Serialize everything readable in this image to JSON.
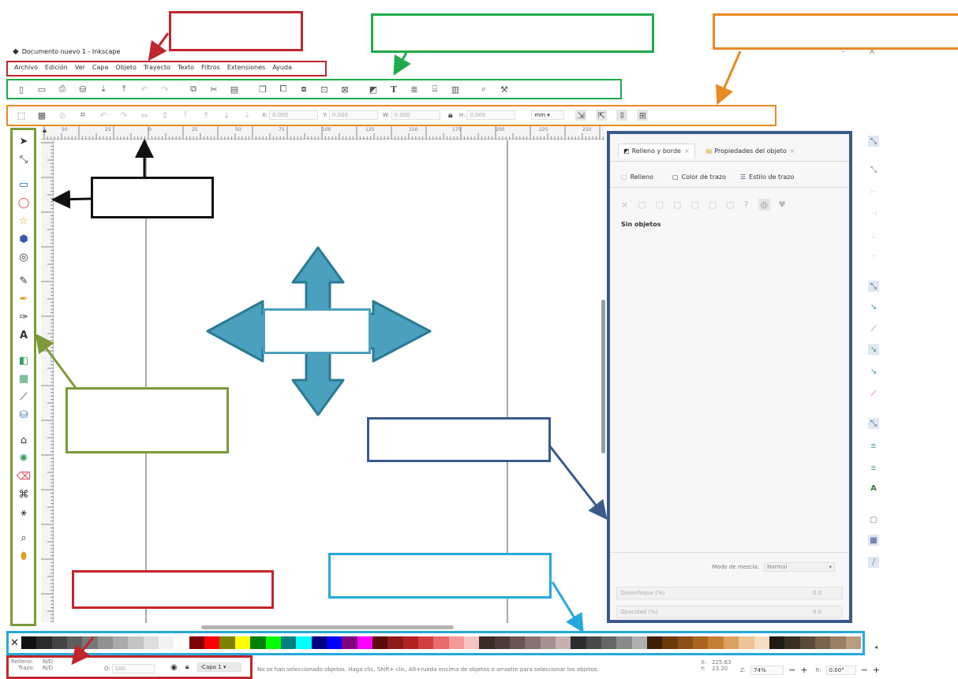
{
  "window": {
    "title": "Documento nuevo 1 - Inkscape"
  },
  "menu": [
    "Archivo",
    "Edición",
    "Ver",
    "Capa",
    "Objeto",
    "Trayecto",
    "Texto",
    "Filtros",
    "Extensiones",
    "Ayuda"
  ],
  "toolbar": {
    "icons": [
      "new-icon",
      "open-icon",
      "print-icon",
      "save-icon",
      "import-icon",
      "export-icon",
      "undo-icon",
      "redo-icon",
      "copy-icon",
      "cut-icon",
      "paste-icon",
      "duplicate-icon",
      "clone-icon",
      "unlink-icon",
      "group-icon",
      "ungroup-icon",
      "fill-stroke-icon",
      "text-icon",
      "layers-icon",
      "xml-icon",
      "align-icon",
      "zoom-icon",
      "preferences-icon"
    ],
    "text_glyph": "T"
  },
  "commands": {
    "x_label": "X:",
    "x_value": "0.000",
    "y_label": "Y:",
    "y_value": "0.000",
    "w_label": "W:",
    "w_value": "0.000",
    "h_label": "H:",
    "h_value": "0.000",
    "unit": "mm"
  },
  "ruler": {
    "labels": [
      "50",
      "25",
      "0",
      "25",
      "50",
      "75",
      "100",
      "125",
      "150",
      "175",
      "200",
      "225",
      "250"
    ]
  },
  "panel": {
    "tabs": [
      "Relleno y borde",
      "Propiedades del objeto"
    ],
    "subtabs": [
      "Relleno",
      "Color de trazo",
      "Estilo de trazo"
    ],
    "paint_icons": [
      "×",
      "?"
    ],
    "status": "Sin objetos",
    "blend_label": "Modo de mezcla:",
    "blend_value": "Normal",
    "blur_label": "Desenfoque (%)",
    "blur_value": "0.0",
    "opacity_label": "Opacidad (%)",
    "opacity_value": "0.0"
  },
  "palette": {
    "colors": [
      "#111111",
      "#2b2b2b",
      "#444444",
      "#5e5e5e",
      "#777777",
      "#919191",
      "#aaaaaa",
      "#c4c4c4",
      "#dddddd",
      "#f2f2f2",
      "#ffffff",
      "#800000",
      "#ff0000",
      "#808000",
      "#ffff00",
      "#008000",
      "#00ff00",
      "#008080",
      "#00ffff",
      "#000080",
      "#0000ff",
      "#800080",
      "#ff00ff",
      "#5c0a0a",
      "#8c1a1a",
      "#b22222",
      "#d33f3f",
      "#e86a6a",
      "#f29a9a",
      "#f7c4c4",
      "#3a2a2a",
      "#4d3a3a",
      "#6b5353",
      "#8a7070",
      "#a88f8f",
      "#c7b0b0",
      "#2c2c2c",
      "#484848",
      "#666666",
      "#8a8a8a",
      "#b0b0b0",
      "#3d2004",
      "#6b3a0a",
      "#8a4f14",
      "#a8651e",
      "#c47f34",
      "#dca160",
      "#ecc495",
      "#f5ddc0",
      "#1f1a14",
      "#3a2f24",
      "#5a4838",
      "#7a624c",
      "#9a7e64",
      "#b89c80"
    ]
  },
  "status": {
    "fill_label": "Relleno:",
    "fill_value": "N/D",
    "stroke_label": "Trazo:",
    "stroke_value": "N/D",
    "opacity_label": "O:",
    "opacity_value": "100",
    "layer": "-Capa 1",
    "message": "No se han seleccionado objetos. Haga clic, Shift+ clic, Alt+rueda encima de objetos o arrastre para seleccionar los objetos.",
    "x_label": "X:",
    "x_value": "225.63",
    "y_label": "Y:",
    "y_value": "23.20",
    "z_label": "Z:",
    "zoom": "74%",
    "r_label": "R:",
    "rotation": "0.00°"
  },
  "colors": {
    "menu_box": "#c0262d",
    "toolbar_box": "#1faa4b",
    "commands_box": "#e98a24",
    "toolbox_box": "#7d9a3a",
    "panel_box": "#3a5a8a",
    "palette_box": "#25a9dc",
    "arrow_fill": "#4aa0bd",
    "arrow_stroke": "#2a7a95"
  }
}
